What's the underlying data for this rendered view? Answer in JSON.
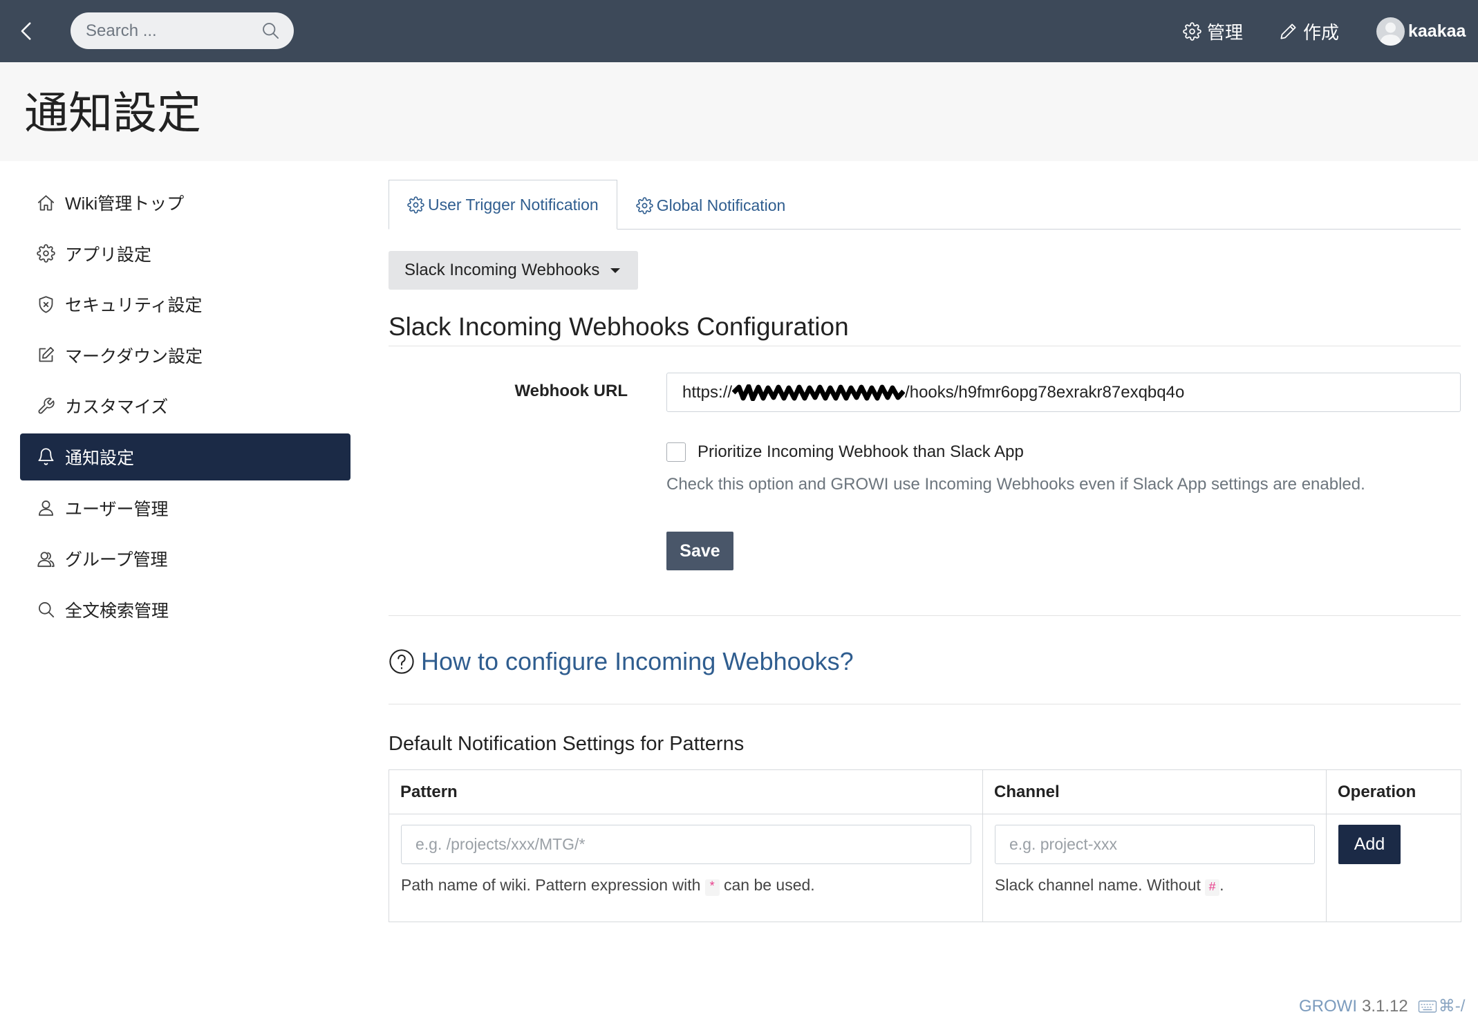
{
  "colors": {
    "navbar": "#3d4959",
    "accent": "#1b2a46",
    "link": "#2f5d8f",
    "save": "#495669"
  },
  "nav": {
    "back_icon": "chevron-left-icon",
    "search_placeholder": "Search ...",
    "admin_label": "管理",
    "create_label": "作成",
    "username": "kaakaa"
  },
  "page": {
    "title": "通知設定"
  },
  "sidebar": {
    "items": [
      {
        "label": "Wiki管理トップ",
        "icon": "home-icon",
        "active": false
      },
      {
        "label": "アプリ設定",
        "icon": "gear-icon",
        "active": false
      },
      {
        "label": "セキュリティ設定",
        "icon": "shield-icon",
        "active": false
      },
      {
        "label": "マークダウン設定",
        "icon": "edit-icon",
        "active": false
      },
      {
        "label": "カスタマイズ",
        "icon": "wrench-icon",
        "active": false
      },
      {
        "label": "通知設定",
        "icon": "bell-icon",
        "active": true
      },
      {
        "label": "ユーザー管理",
        "icon": "user-icon",
        "active": false
      },
      {
        "label": "グループ管理",
        "icon": "users-icon",
        "active": false
      },
      {
        "label": "全文検索管理",
        "icon": "search-icon",
        "active": false
      }
    ]
  },
  "tabs": [
    {
      "label": "User Trigger Notification",
      "icon": "gear-icon",
      "active": true
    },
    {
      "label": "Global Notification",
      "icon": "gear-icon",
      "active": false
    }
  ],
  "dropdown": {
    "selected": "Slack Incoming Webhooks"
  },
  "config": {
    "heading": "Slack Incoming Webhooks Configuration",
    "webhook_label": "Webhook URL",
    "webhook_prefix": "https://",
    "webhook_suffix": "/hooks/h9fmr6opg78exrakr87exqbq4o",
    "prioritize_label": "Prioritize Incoming Webhook than Slack App",
    "prioritize_checked": false,
    "help": "Check this option and GROWI use Incoming Webhooks even if Slack App settings are enabled.",
    "save_label": "Save"
  },
  "howto": {
    "label": "How to configure Incoming Webhooks?"
  },
  "patterns": {
    "heading": "Default Notification Settings for Patterns",
    "columns": [
      "Pattern",
      "Channel",
      "Operation"
    ],
    "pattern_placeholder": "e.g. /projects/xxx/MTG/*",
    "pattern_help_before": "Path name of wiki. Pattern expression with",
    "pattern_help_code": "*",
    "pattern_help_after": "can be used.",
    "channel_placeholder": "e.g. project-xxx",
    "channel_help_before": "Slack channel name. Without",
    "channel_help_code": "#",
    "channel_help_after": ".",
    "add_label": "Add"
  },
  "footer": {
    "app": "GROWI",
    "version": "3.1.12",
    "shortcut": "⌘-/"
  }
}
